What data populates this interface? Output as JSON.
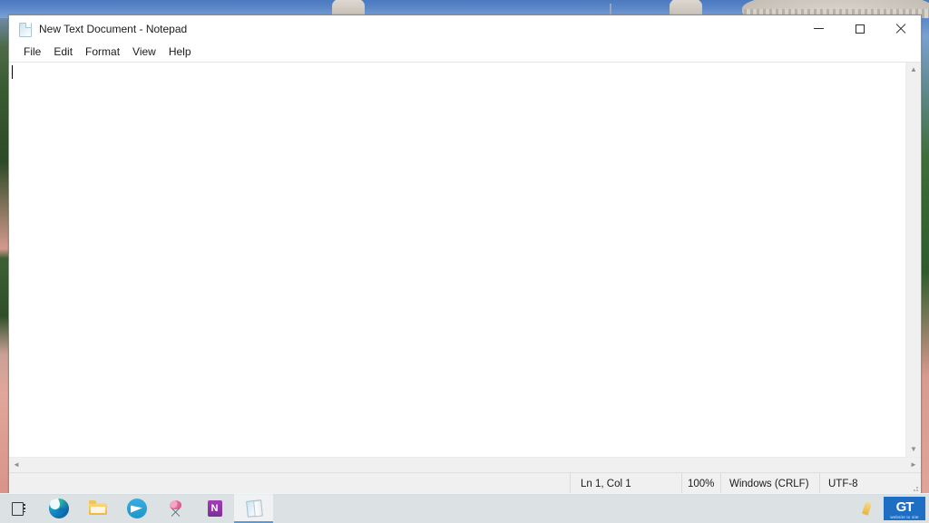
{
  "desktop": {
    "wallpaper_description": "taj-mahal-garden-wallpaper",
    "sky_color": "#5c88c8",
    "grass_color": "#2f5c2d",
    "path_color": "#de9f92"
  },
  "window": {
    "title": "New Text Document - Notepad",
    "icon": "notepad-document-icon",
    "controls": {
      "minimize": "Minimize",
      "maximize": "Maximize",
      "close": "Close"
    },
    "menu": [
      {
        "label": "File"
      },
      {
        "label": "Edit"
      },
      {
        "label": "Format"
      },
      {
        "label": "View"
      },
      {
        "label": "Help"
      }
    ],
    "editor": {
      "content": "",
      "caret_visible": true
    },
    "scrollbars": {
      "vertical_up": "▲",
      "vertical_down": "▼",
      "horizontal_left": "◄",
      "horizontal_right": "►"
    },
    "statusbar": {
      "cursor_position": "Ln 1, Col 1",
      "zoom": "100%",
      "line_ending": "Windows (CRLF)",
      "encoding": "UTF-8"
    }
  },
  "taskbar": {
    "background_color": "#dbe9ee",
    "items": [
      {
        "name": "task-view",
        "label": "Task View",
        "icon": "task-view-icon",
        "active": false
      },
      {
        "name": "microsoft-edge",
        "label": "Microsoft Edge",
        "icon": "edge-icon",
        "active": false
      },
      {
        "name": "file-explorer",
        "label": "File Explorer",
        "icon": "folder-icon",
        "active": false
      },
      {
        "name": "telegram",
        "label": "Telegram",
        "icon": "telegram-icon",
        "active": false
      },
      {
        "name": "paint-3d",
        "label": "Paint 3D",
        "icon": "paint-palette-icon",
        "active": false
      },
      {
        "name": "onenote",
        "label": "OneNote",
        "icon": "onenote-icon",
        "active": false
      },
      {
        "name": "notepad",
        "label": "New Text Document - Notepad",
        "icon": "notepad-icon",
        "active": true
      }
    ],
    "tray": [
      {
        "name": "tray-pen",
        "label": "Windows Ink Workspace",
        "icon": "pen-icon"
      }
    ],
    "watermark": {
      "mark": "GT",
      "subtitle": "website to site"
    }
  }
}
